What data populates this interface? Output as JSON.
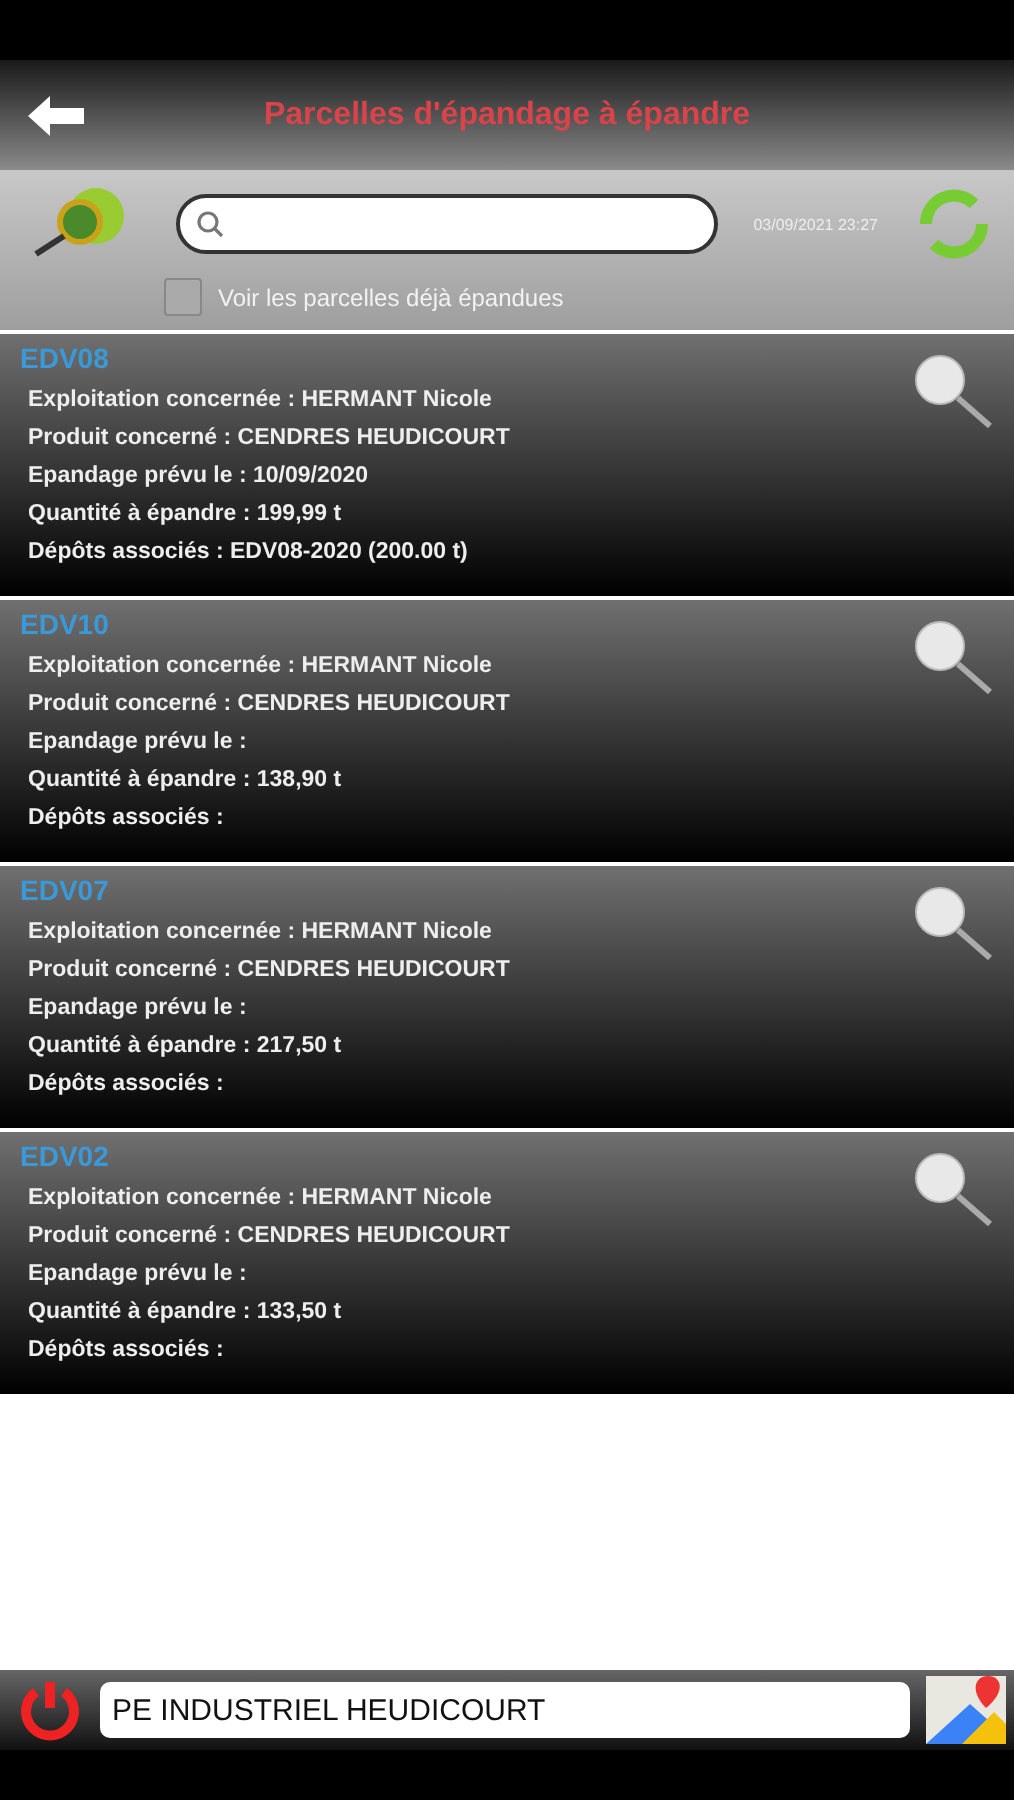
{
  "header": {
    "title": "Parcelles d'épandage à épandre"
  },
  "toolbar": {
    "timestamp": "03/09/2021 23:27",
    "show_spread": {
      "label": "Voir les parcelles déjà épandues",
      "checked": false
    }
  },
  "parcels": [
    {
      "code": "EDV08",
      "lines": [
        "Exploitation concernée : HERMANT Nicole",
        "Produit concerné : CENDRES HEUDICOURT",
        "Epandage prévu le : 10/09/2020",
        "Quantité à épandre : 199,99 t",
        "Dépôts associés : EDV08-2020 (200.00 t)"
      ]
    },
    {
      "code": "EDV10",
      "lines": [
        "Exploitation concernée : HERMANT Nicole",
        "Produit concerné : CENDRES HEUDICOURT",
        "Epandage prévu le :",
        "Quantité à épandre : 138,90 t",
        "Dépôts associés :"
      ]
    },
    {
      "code": "EDV07",
      "lines": [
        "Exploitation concernée : HERMANT Nicole",
        "Produit concerné : CENDRES HEUDICOURT",
        "Epandage prévu le :",
        "Quantité à épandre : 217,50 t",
        "Dépôts associés :"
      ]
    },
    {
      "code": "EDV02",
      "lines": [
        "Exploitation concernée : HERMANT Nicole",
        "Produit concerné : CENDRES HEUDICOURT",
        "Epandage prévu le :",
        "Quantité à épandre : 133,50 t",
        "Dépôts associés :"
      ]
    }
  ],
  "footer": {
    "site": "PE INDUSTRIEL HEUDICOURT"
  }
}
